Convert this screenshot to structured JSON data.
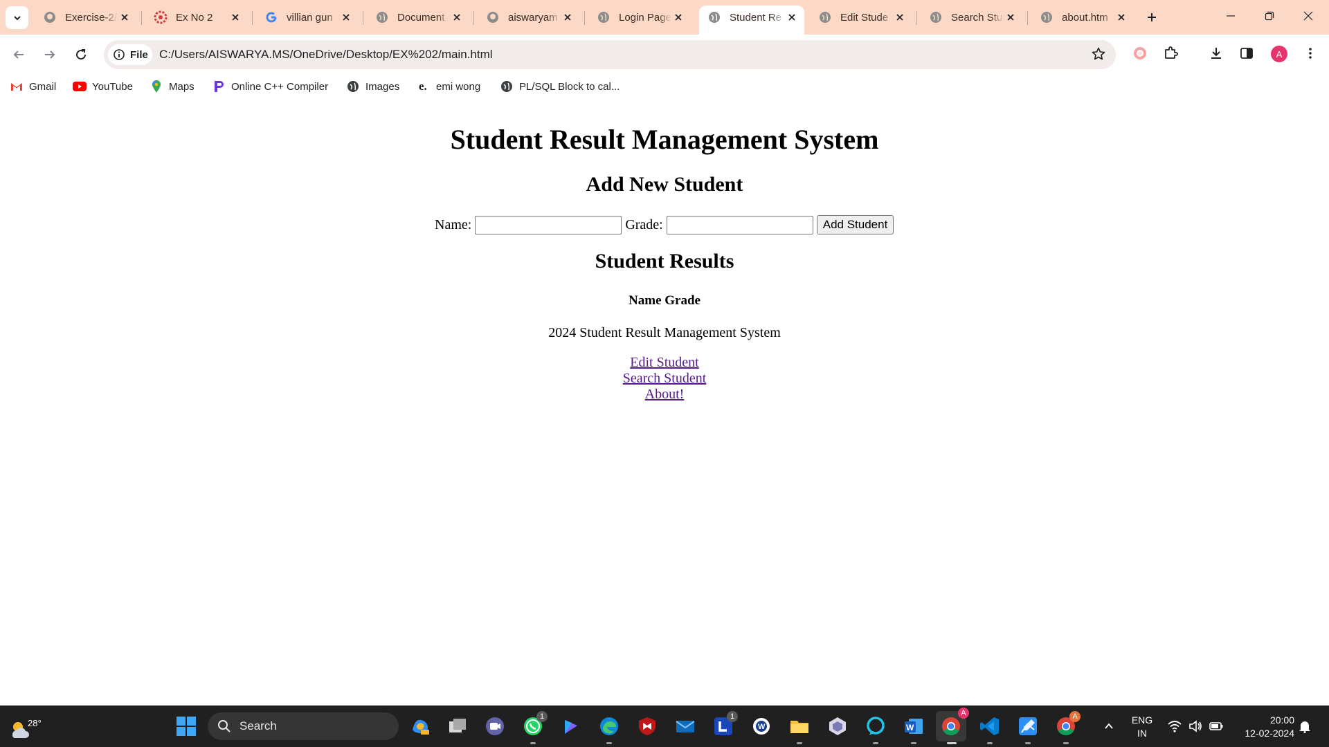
{
  "browser": {
    "tabs": [
      {
        "label": "Exercise-2/",
        "favicon": "github-icon",
        "active": false
      },
      {
        "label": "Ex No 2",
        "favicon": "gear-red-icon",
        "active": false
      },
      {
        "label": "villian gun",
        "favicon": "google-icon",
        "active": false
      },
      {
        "label": "Document",
        "favicon": "globe-icon",
        "active": false
      },
      {
        "label": "aiswaryam",
        "favicon": "github-icon",
        "active": false
      },
      {
        "label": "Login Page",
        "favicon": "globe-icon",
        "active": false
      },
      {
        "label": "Student Re",
        "favicon": "globe-icon",
        "active": true
      },
      {
        "label": "Edit Stude",
        "favicon": "globe-icon",
        "active": false
      },
      {
        "label": "Search Stu",
        "favicon": "globe-icon",
        "active": false
      },
      {
        "label": "about.htm",
        "favicon": "globe-icon",
        "active": false
      }
    ],
    "address": {
      "scheme_chip": "File",
      "url": "C:/Users/AISWARYA.MS/OneDrive/Desktop/EX%202/main.html"
    },
    "profile_initial": "A",
    "bookmarks": [
      {
        "label": "Gmail",
        "icon": "gmail-icon"
      },
      {
        "label": "YouTube",
        "icon": "youtube-icon"
      },
      {
        "label": "Maps",
        "icon": "maps-icon"
      },
      {
        "label": "Online C++ Compiler",
        "icon": "compiler-icon"
      },
      {
        "label": "Images",
        "icon": "globe-icon"
      },
      {
        "label": "emi wong",
        "icon": "e-icon"
      },
      {
        "label": "PL/SQL Block to cal...",
        "icon": "globe-icon"
      }
    ]
  },
  "page": {
    "title": "Student Result Management System",
    "add_heading": "Add New Student",
    "name_label": "Name:",
    "name_value": "",
    "grade_label": "Grade:",
    "grade_value": "",
    "add_button": "Add Student",
    "results_heading": "Student Results",
    "table_headers": [
      "Name",
      "Grade"
    ],
    "footer": "2024 Student Result Management System",
    "links": [
      "Edit Student",
      "Search Student",
      "About!"
    ],
    "link_color": "#551a8b"
  },
  "taskbar": {
    "weather_temp": "28°",
    "search_placeholder": "Search",
    "whatsapp_badge": "1",
    "word_l_badge": "1",
    "chrome_badge": "A",
    "chrome2_badge": "A",
    "language_line1": "ENG",
    "language_line2": "IN",
    "time": "20:00",
    "date": "12-02-2024"
  },
  "colors": {
    "tabstrip": "#fbd9c6",
    "taskbar": "#202020"
  }
}
